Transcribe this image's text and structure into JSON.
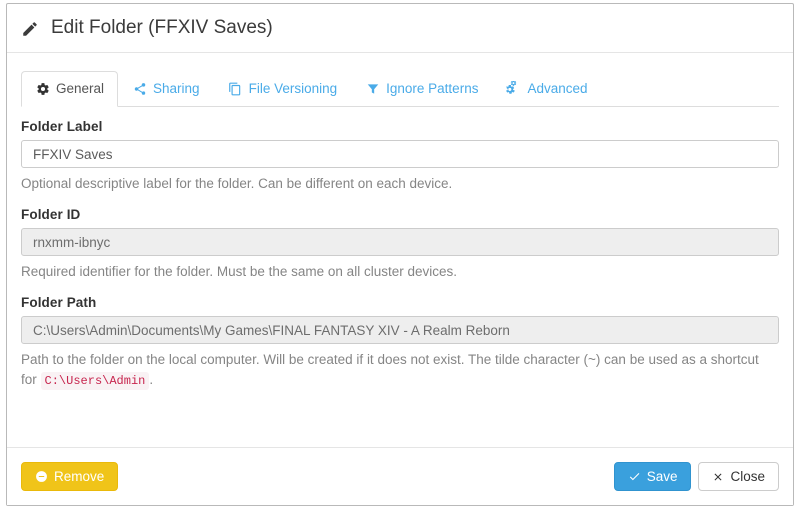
{
  "header": {
    "title": "Edit Folder (FFXIV Saves)",
    "icon": "pencil-icon"
  },
  "tabs": [
    {
      "label": "General",
      "icon": "gear-icon",
      "active": true
    },
    {
      "label": "Sharing",
      "icon": "share-icon",
      "active": false
    },
    {
      "label": "File Versioning",
      "icon": "copy-icon",
      "active": false
    },
    {
      "label": "Ignore Patterns",
      "icon": "filter-icon",
      "active": false
    },
    {
      "label": "Advanced",
      "icon": "cogs-icon",
      "active": false
    }
  ],
  "form": {
    "folder_label": {
      "label": "Folder Label",
      "value": "FFXIV Saves",
      "placeholder": "",
      "help": "Optional descriptive label for the folder. Can be different on each device.",
      "disabled": false
    },
    "folder_id": {
      "label": "Folder ID",
      "value": "rnxmm-ibnyc",
      "placeholder": "",
      "help": "Required identifier for the folder. Must be the same on all cluster devices.",
      "disabled": true
    },
    "folder_path": {
      "label": "Folder Path",
      "value": "C:\\Users\\Admin\\Documents\\My Games\\FINAL FANTASY XIV - A Realm Reborn",
      "placeholder": "",
      "help_part1": "Path to the folder on the local computer. Will be created if it does not exist. The tilde character (~) can be used as a shortcut for",
      "help_code": "C:\\Users\\Admin",
      "help_part2": ".",
      "disabled": true
    }
  },
  "footer": {
    "remove_label": "Remove",
    "save_label": "Save",
    "close_label": "Close"
  },
  "colors": {
    "link": "#4aabe8",
    "primary": "#3aa0dd",
    "warning": "#f0c419",
    "code_text": "#c7254e",
    "code_bg": "#f9f2f4"
  }
}
